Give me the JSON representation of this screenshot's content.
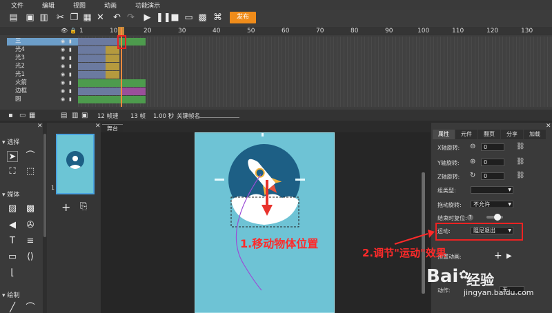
{
  "menu": [
    "文件",
    "编辑",
    "视图",
    "动画",
    "功能演示"
  ],
  "toolbar": {
    "publish_label": "发布"
  },
  "timeline": {
    "ticks": [
      "1",
      "10",
      "20",
      "30",
      "40",
      "50",
      "60",
      "70",
      "80",
      "90",
      "100",
      "110",
      "120",
      "130"
    ],
    "layers": [
      "三",
      "光4",
      "光3",
      "光2",
      "光1",
      "火箭",
      "边框",
      "圆"
    ],
    "status": {
      "fps": "12 帧速",
      "frames": "13 帧",
      "seconds": "1.00 秒",
      "keyframe_name_label": "关键帧名"
    }
  },
  "left_panel": {
    "sections": [
      "选择",
      "媒体",
      "绘制"
    ]
  },
  "scene": {
    "number": "1"
  },
  "stage": {
    "tab_label": "舞台"
  },
  "right_panel": {
    "tabs": [
      "属性",
      "元件",
      "翻页",
      "分享",
      "加载"
    ],
    "props": {
      "x_label": "X轴旋转:",
      "x_value": "0",
      "y_label": "Y轴旋转:",
      "y_value": "0",
      "z_label": "Z轴旋转:",
      "z_value": "0",
      "group_type_label": "组类型:",
      "group_type_value": "",
      "drag_rotate_label": "拖动旋转:",
      "drag_rotate_value": "不允许",
      "reset_label": "结束时复位:",
      "motion_label": "运动:",
      "motion_value": "阻尼退出",
      "preset_label": "预置动画:",
      "action_label": "动作:",
      "action_value": "无"
    }
  },
  "annotations": {
    "step1": "1.移动物体位置",
    "step2": "2.调节\"运动\"效果"
  },
  "watermark": {
    "brand": "Bai",
    "brand2": "经验",
    "url": "jingyan.baidu.com"
  },
  "colors": {
    "accent": "#f08c1a",
    "canvas": "#6ec3d5",
    "annotation": "#ff2a2a"
  }
}
